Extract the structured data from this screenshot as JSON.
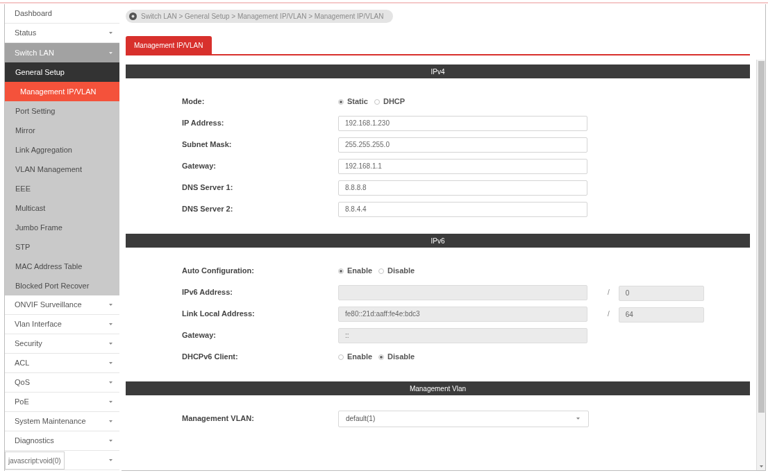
{
  "sidebar": {
    "items": [
      {
        "kind": "link",
        "label": "Dashboard",
        "selected": false
      },
      {
        "kind": "menu",
        "label": "Status",
        "selected": false,
        "expanded": false
      },
      {
        "kind": "menu",
        "label": "Switch LAN",
        "selected": false,
        "expanded": true,
        "children": [
          {
            "label": "General Setup",
            "selected": false,
            "expanded": true,
            "children": [
              {
                "label": "Management IP/VLAN",
                "selected": true
              }
            ]
          },
          {
            "label": "Port Setting",
            "selected": false
          },
          {
            "label": "Mirror",
            "selected": false
          },
          {
            "label": "Link Aggregation",
            "selected": false
          },
          {
            "label": "VLAN Management",
            "selected": false
          },
          {
            "label": "EEE",
            "selected": false
          },
          {
            "label": "Multicast",
            "selected": false
          },
          {
            "label": "Jumbo Frame",
            "selected": false
          },
          {
            "label": "STP",
            "selected": false
          },
          {
            "label": "MAC Address Table",
            "selected": false
          },
          {
            "label": "Blocked Port Recover",
            "selected": false
          }
        ]
      },
      {
        "kind": "menu",
        "label": "ONVIF Surveillance",
        "selected": false,
        "expanded": false
      },
      {
        "kind": "menu",
        "label": "Vlan Interface",
        "selected": false,
        "expanded": false
      },
      {
        "kind": "menu",
        "label": "Security",
        "selected": false,
        "expanded": false
      },
      {
        "kind": "menu",
        "label": "ACL",
        "selected": false,
        "expanded": false
      },
      {
        "kind": "menu",
        "label": "QoS",
        "selected": false,
        "expanded": false
      },
      {
        "kind": "menu",
        "label": "PoE",
        "selected": false,
        "expanded": false
      },
      {
        "kind": "menu",
        "label": "System Maintenance",
        "selected": false,
        "expanded": false
      },
      {
        "kind": "menu",
        "label": "Diagnostics",
        "selected": false,
        "expanded": false
      },
      {
        "kind": "menu",
        "selected": false,
        "expanded": false
      }
    ]
  },
  "status_tooltip": {
    "text": "javascript:void(0)"
  },
  "breadcrumb": {
    "text": "Switch LAN > General Setup > Management IP/VLAN > Management IP/VLAN"
  },
  "tabs": [
    {
      "label": "Management IP/VLAN",
      "selected": true
    }
  ],
  "sections": [
    {
      "title": "IPv4",
      "rows": [
        {
          "kind": "radio",
          "label": "Mode:",
          "options": [
            {
              "label": "Static",
              "selected": true
            },
            {
              "label": "DHCP",
              "selected": false
            }
          ]
        },
        {
          "kind": "text",
          "label": "IP Address:",
          "value": "192.168.1.230",
          "disabled": false
        },
        {
          "kind": "text",
          "label": "Subnet Mask:",
          "value": "255.255.255.0",
          "disabled": false
        },
        {
          "kind": "text",
          "label": "Gateway:",
          "value": "192.168.1.1",
          "disabled": false
        },
        {
          "kind": "text",
          "label": "DNS Server 1:",
          "value": "8.8.8.8",
          "disabled": false
        },
        {
          "kind": "text",
          "label": "DNS Server 2:",
          "value": "8.8.4.4",
          "disabled": false
        }
      ]
    },
    {
      "title": "IPv6",
      "rows": [
        {
          "kind": "radio",
          "label": "Auto Configuration:",
          "options": [
            {
              "label": "Enable",
              "selected": true
            },
            {
              "label": "Disable",
              "selected": false
            }
          ]
        },
        {
          "kind": "text",
          "label": "IPv6 Address:",
          "disabled": true,
          "prefix_length": {
            "separator": "/",
            "value": "0"
          }
        },
        {
          "kind": "text",
          "label": "Link Local Address:",
          "value": "fe80::21d:aaff:fe4e:bdc3",
          "disabled": true,
          "prefix_length": {
            "separator": "/",
            "value": "64"
          }
        },
        {
          "kind": "text",
          "label": "Gateway:",
          "value": "::",
          "disabled": true
        },
        {
          "kind": "radio",
          "label": "DHCPv6 Client:",
          "options": [
            {
              "label": "Enable",
              "selected": false
            },
            {
              "label": "Disable",
              "selected": true
            }
          ]
        }
      ]
    },
    {
      "title": "Management Vlan",
      "rows": [
        {
          "kind": "select",
          "label": "Management VLAN:",
          "value": "default(1)"
        }
      ]
    }
  ]
}
